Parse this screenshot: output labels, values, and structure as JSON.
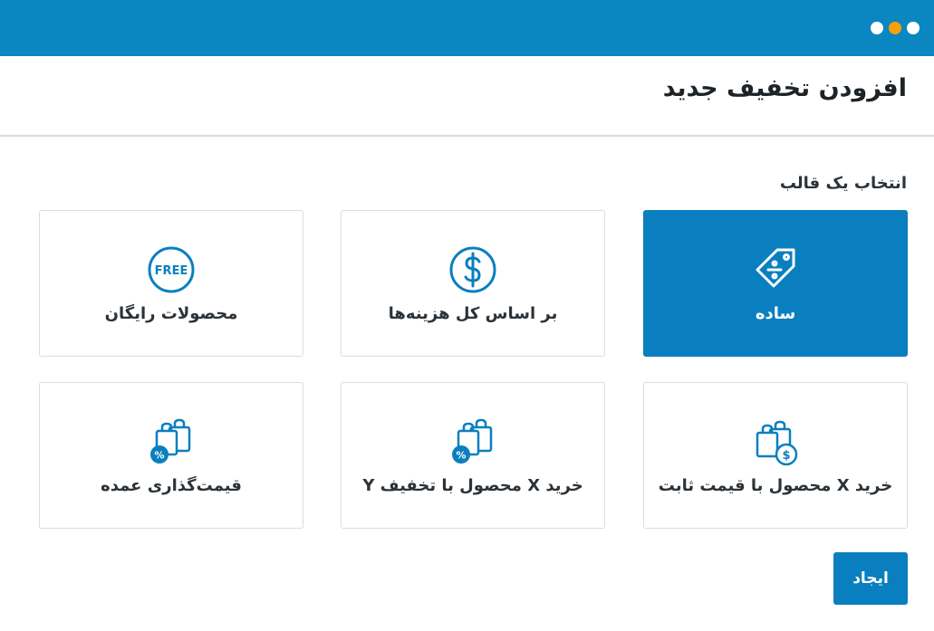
{
  "header": {
    "title": "افزودن تخفیف جدید"
  },
  "section": {
    "label": "انتخاب یک قالب"
  },
  "templates": [
    {
      "label": "ساده",
      "icon": "discount-tag-icon",
      "selected": true
    },
    {
      "label": "بر اساس کل هزینه‌ها",
      "icon": "dollar-circle-icon",
      "selected": false
    },
    {
      "label": "محصولات رایگان",
      "icon": "free-badge-icon",
      "icon_text": "FREE",
      "selected": false
    },
    {
      "label": "خرید X محصول با قیمت ثابت",
      "icon": "shopping-bags-dollar-icon",
      "selected": false
    },
    {
      "label": "خرید X محصول با تخفیف Y",
      "icon": "shopping-bags-percent-icon",
      "selected": false
    },
    {
      "label": "قیمت‌گذاری عمده",
      "icon": "shopping-bags-percent-icon",
      "selected": false
    }
  ],
  "actions": {
    "create_label": "ایجاد"
  },
  "colors": {
    "topbar": "#0a86c0",
    "accent": "#0a7fbf",
    "dot_highlight": "#f6a10a"
  }
}
